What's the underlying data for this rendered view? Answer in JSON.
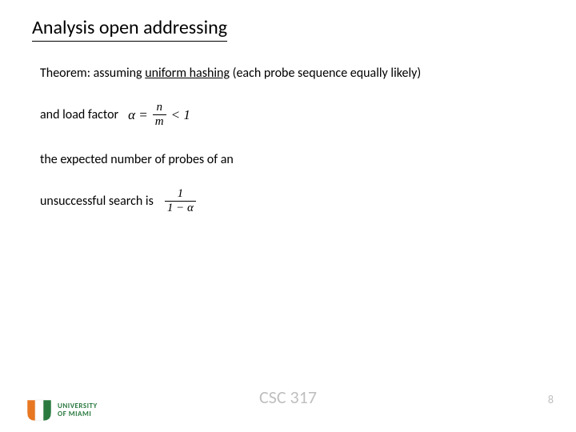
{
  "title": "Analysis open addressing",
  "theorem": {
    "prefix": "Theorem: assuming ",
    "emph": "uniform hashing",
    "suffix": " (each probe sequence equally likely)"
  },
  "loadfactor_label": "and load factor",
  "formula1": {
    "lhs": "α =",
    "num": "n",
    "den": "m",
    "cmp": "< 1"
  },
  "line3": "the expected number of probes of an",
  "line4_label": "unsuccessful search is",
  "formula2": {
    "num": "1",
    "den": "1 − α"
  },
  "logo": {
    "line1": "UNIVERSITY",
    "line2": "OF MIAMI"
  },
  "course": "CSC 317",
  "pagenum": "8"
}
